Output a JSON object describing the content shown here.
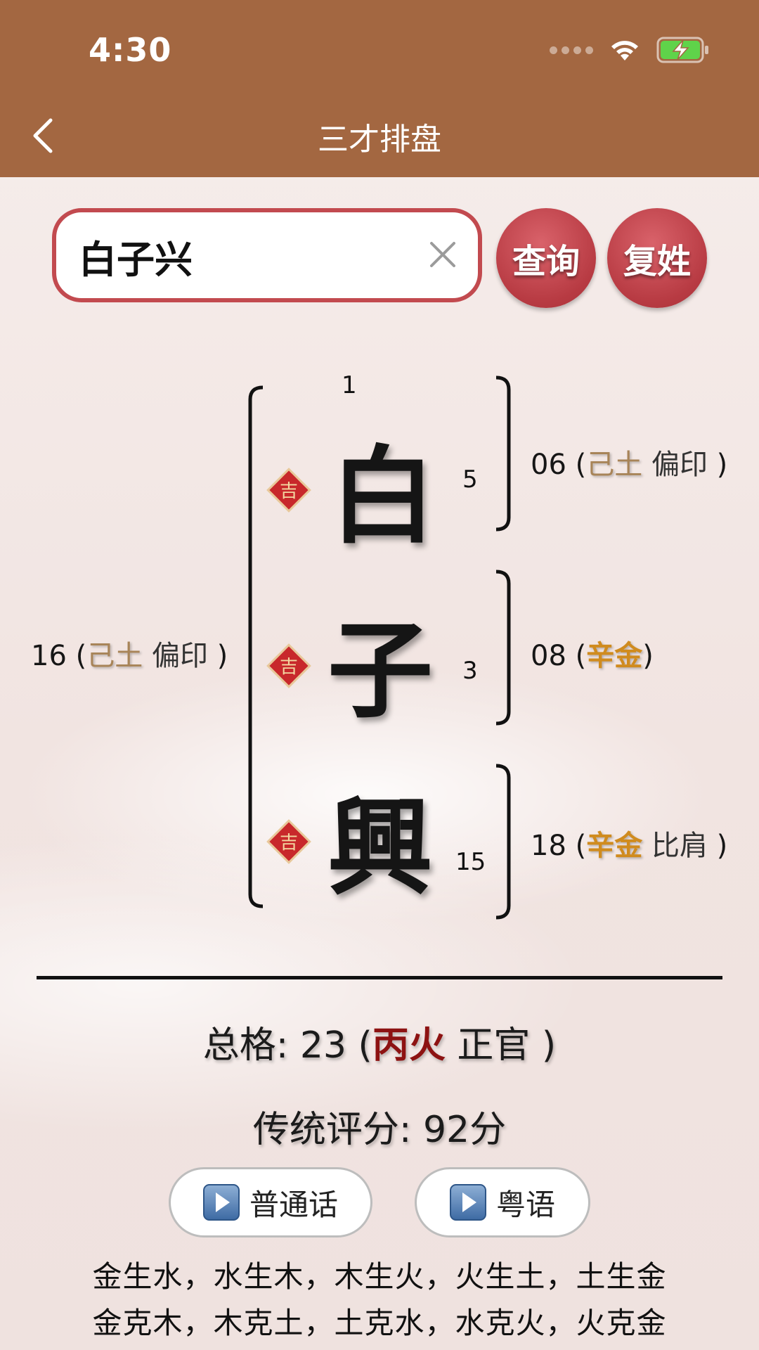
{
  "status_bar": {
    "time": "4:30"
  },
  "nav": {
    "title": "三才排盘"
  },
  "search": {
    "value": "白子兴"
  },
  "buttons": {
    "query": "查询",
    "compound_surname": "复姓"
  },
  "diagram": {
    "characters": [
      {
        "char": "白",
        "top_num": "1",
        "strokes": "5",
        "badge": "吉"
      },
      {
        "char": "子",
        "strokes": "3",
        "badge": "吉"
      },
      {
        "char": "興",
        "strokes": "15",
        "badge": "吉"
      }
    ],
    "tian_ge": {
      "num": "06",
      "element": "己土",
      "relation": "偏印"
    },
    "ren_ge": {
      "num": "08",
      "element": "辛金"
    },
    "di_ge": {
      "num": "18",
      "element": "辛金",
      "relation": "比肩"
    },
    "wai_ge": {
      "num": "16",
      "element": "己土",
      "relation": "偏印"
    }
  },
  "summary": {
    "total_label": "总格",
    "total_num": "23",
    "total_element": "丙火",
    "total_relation": "正官",
    "score_label": "传统评分",
    "score_value": "92分"
  },
  "audio": {
    "mandarin": "普通话",
    "cantonese": "粤语"
  },
  "rules": [
    "金生水，水生木，木生火，火生土，土生金",
    "金克木，木克土，土克水，水克火，火克金",
    "",
    ""
  ],
  "colors": {
    "topbar": "#a36741",
    "accent_red": "#c24a4f",
    "gold": "#a88458",
    "orange": "#d08b1e",
    "dark_red": "#8d1212"
  }
}
